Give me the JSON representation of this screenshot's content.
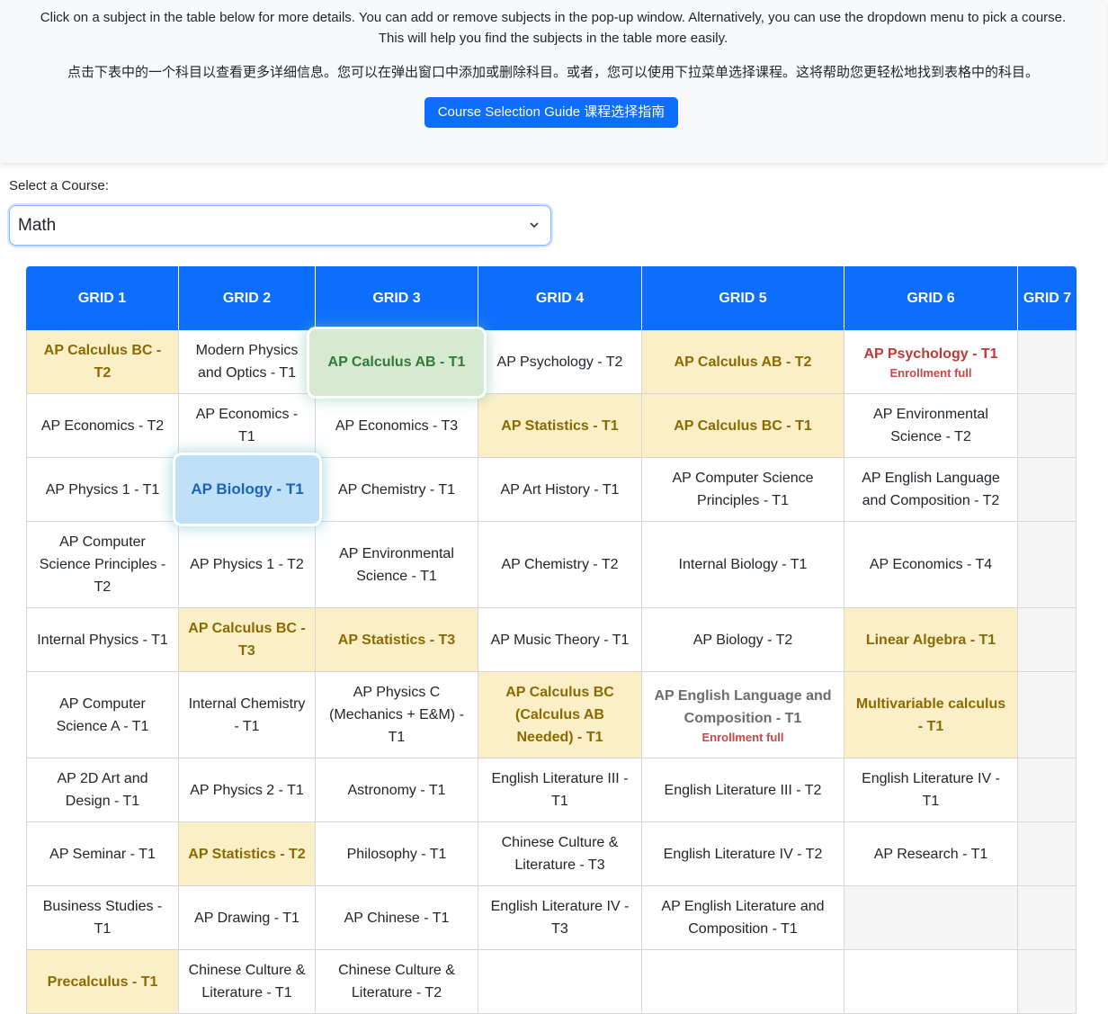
{
  "intro": {
    "english": "Click on a subject in the table below for more details. You can add or remove subjects in the pop-up window. Alternatively, you can use the dropdown menu to pick a course. This will help you find the subjects in the table more easily.",
    "chinese": "点击下表中的一个科目以查看更多详细信息。您可以在弹出窗口中添加或删除科目。或者，您可以使用下拉菜单选择课程。这将帮助您更轻松地找到表格中的科目。",
    "guide_button": "Course Selection Guide 课程选择指南"
  },
  "course_select": {
    "label": "Select a Course:",
    "selected": "Math"
  },
  "colors": {
    "primary": "#0d6efd",
    "math_highlight": "#fbefc8",
    "selected_green": "#d6ead2",
    "selected_blue": "#bfe1f7",
    "enrollment_full": "#d04545"
  },
  "grid": {
    "headers": [
      "GRID 1",
      "GRID 2",
      "GRID 3",
      "GRID 4",
      "GRID 5",
      "GRID 6",
      "GRID 7"
    ],
    "rows": [
      [
        "AP Calculus BC - T2",
        "Modern Physics and Optics - T1",
        "AP Calculus AB - T1",
        "AP Psychology - T2",
        "AP Calculus AB - T2",
        "AP Psychology - T1",
        ""
      ],
      [
        "AP Economics - T2",
        "AP Economics - T1",
        "AP Economics - T3",
        "AP Statistics - T1",
        "AP Calculus BC - T1",
        "AP Environmental Science - T2",
        ""
      ],
      [
        "AP Physics 1 - T1",
        "AP Biology - T1",
        "AP Chemistry - T1",
        "AP Art History - T1",
        "AP Computer Science Principles - T1",
        "AP English Language and Composition - T2",
        ""
      ],
      [
        "AP Computer Science Principles - T2",
        "AP Physics 1 - T2",
        "AP Environmental Science - T1",
        "AP Chemistry - T2",
        "Internal Biology - T1",
        "AP Economics - T4",
        ""
      ],
      [
        "Internal Physics - T1",
        "AP Calculus BC - T3",
        "AP Statistics - T3",
        "AP Music Theory - T1",
        "AP Biology - T2",
        "Linear Algebra - T1",
        ""
      ],
      [
        "AP Computer Science A - T1",
        "Internal Chemistry - T1",
        "AP Physics C (Mechanics + E&M) - T1",
        "AP Calculus BC (Calculus AB Needed) - T1",
        "AP English Language and Composition - T1",
        "Multivariable calculus - T1",
        ""
      ],
      [
        "AP 2D Art and Design - T1",
        "AP Physics 2 - T1",
        "Astronomy - T1",
        "English Literature III - T1",
        "English Literature III - T2",
        "English Literature IV - T1",
        ""
      ],
      [
        "AP Seminar - T1",
        "AP Statistics - T2",
        "Philosophy - T1",
        "Chinese Culture & Literature - T3",
        "English Literature IV - T2",
        "AP Research - T1",
        ""
      ],
      [
        "Business Studies - T1",
        "AP Drawing - T1",
        "AP Chinese - T1",
        "English Literature IV - T3",
        "AP English Literature and Composition - T1",
        "",
        ""
      ],
      [
        "Precalculus - T1",
        "Chinese Culture & Literature - T1",
        "Chinese Culture & Literature - T2",
        "",
        "",
        "",
        ""
      ]
    ],
    "enrollment_full_note": "Enrollment full"
  }
}
